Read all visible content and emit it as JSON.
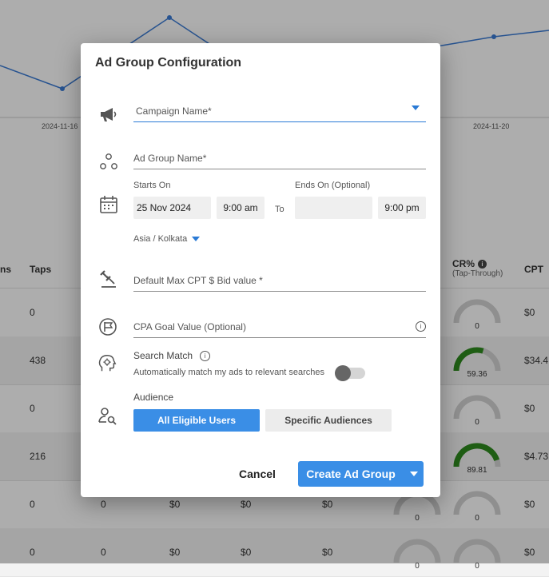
{
  "background": {
    "chart": {
      "x_ticks": [
        "2024-11-16",
        "2024-11-20"
      ]
    },
    "table": {
      "headers": [
        "ns",
        "Taps",
        "CR%",
        "CPT"
      ],
      "cr_sub": "(Tap-Through)",
      "info_glyph": "i",
      "rows": [
        {
          "taps": "0",
          "c3": "",
          "c4": "",
          "c5": "",
          "g1": "",
          "cr": "0",
          "cpt": "$0"
        },
        {
          "taps": "438",
          "c3": "",
          "c4": "",
          "c5": "",
          "g1": "",
          "cr": "59.36",
          "cpt": "$34.4"
        },
        {
          "taps": "0",
          "c3": "",
          "c4": "",
          "c5": "",
          "g1": "",
          "cr": "0",
          "cpt": "$0"
        },
        {
          "taps": "216",
          "c3": "",
          "c4": "",
          "c5": "",
          "g1": "",
          "cr": "89.81",
          "cpt": "$4.73"
        },
        {
          "taps": "0",
          "c2": "0",
          "c3": "$0",
          "c4": "$0",
          "c5": "$0",
          "g1": "0",
          "cr": "0",
          "cpt": "$0"
        },
        {
          "taps": "0",
          "c2": "0",
          "c3": "$0",
          "c4": "$0",
          "c5": "$0",
          "g1": "0",
          "cr": "0",
          "cpt": "$0"
        }
      ],
      "gauge_colors": {
        "track": "#d3d3d3",
        "fill": "#2e8b1e"
      },
      "gauge_levels": [
        0,
        0.5936,
        0,
        0.8981,
        0,
        0
      ]
    }
  },
  "dialog": {
    "title": "Ad Group Configuration",
    "campaign_label": "Campaign Name*",
    "adgroup_label": "Ad Group Name*",
    "starts_label": "Starts On",
    "start_date": "25 Nov 2024",
    "start_time": "9:00 am",
    "to_label": "To",
    "ends_label": "Ends On (Optional)",
    "end_date": "",
    "end_time": "9:00 pm",
    "timezone": "Asia / Kolkata",
    "bid_label": "Default Max CPT $ Bid value *",
    "cpa_label": "CPA Goal Value (Optional)",
    "search_match_title": "Search Match",
    "search_match_desc": "Automatically match my ads to relevant searches",
    "info_glyph": "i",
    "audience_title": "Audience",
    "audience_all": "All Eligible Users",
    "audience_specific": "Specific Audiences",
    "cancel": "Cancel",
    "create": "Create Ad Group",
    "accent": "#3a8ee6"
  }
}
